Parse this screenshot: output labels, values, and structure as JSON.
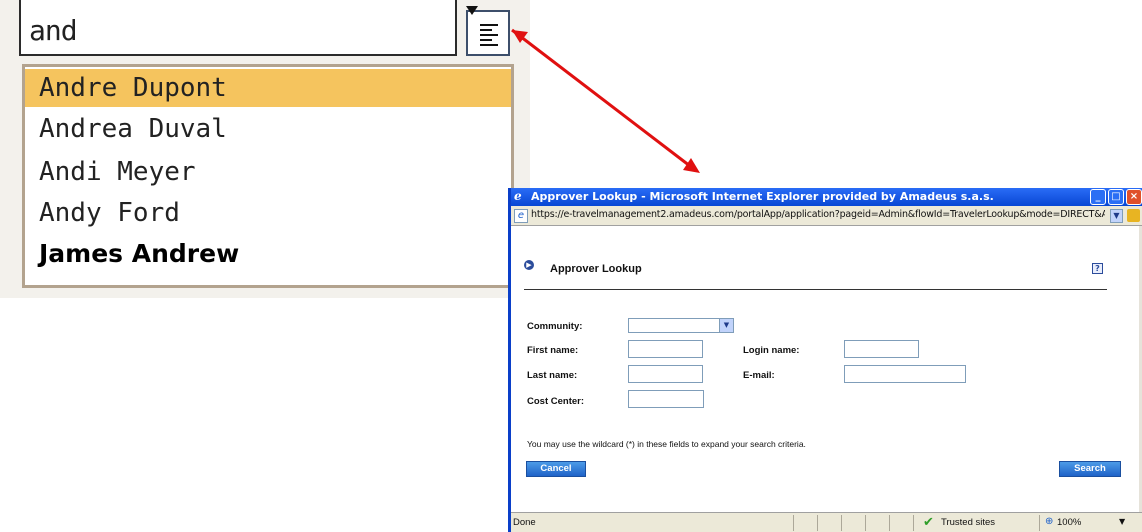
{
  "autocomplete": {
    "input_value": "and",
    "suggestions": [
      {
        "label": "Andre Dupont",
        "highlighted": true
      },
      {
        "label": "Andrea Duval"
      },
      {
        "label": "Andi Meyer"
      },
      {
        "label": "Andy Ford"
      },
      {
        "label": "James Andrew",
        "bold": true
      }
    ],
    "highlight_color": "#f5c45e",
    "list_icon": "list-icon"
  },
  "arrow_color": "#e01010",
  "ie_window": {
    "title": "Approver Lookup - Microsoft Internet Explorer provided by Amadeus s.a.s.",
    "address": "https://e-travelmanagement2.amadeus.com/portalApp/application?pageid=Admin&flowId=TravelerLookup&mode=DIRECT&A(",
    "title_bar_color": "#0747d4"
  },
  "page": {
    "title": "Approver Lookup",
    "help_icon": "?",
    "fields": {
      "community_label": "Community:",
      "first_name_label": "First name:",
      "login_name_label": "Login name:",
      "last_name_label": "Last name:",
      "email_label": "E-mail:",
      "cost_center_label": "Cost Center:"
    },
    "hint": "You may use the wildcard (*) in these fields to expand your search criteria.",
    "cancel_label": "Cancel",
    "search_label": "Search"
  },
  "status_bar": {
    "text": "Done",
    "zone": "Trusted sites",
    "zoom": "100%"
  }
}
